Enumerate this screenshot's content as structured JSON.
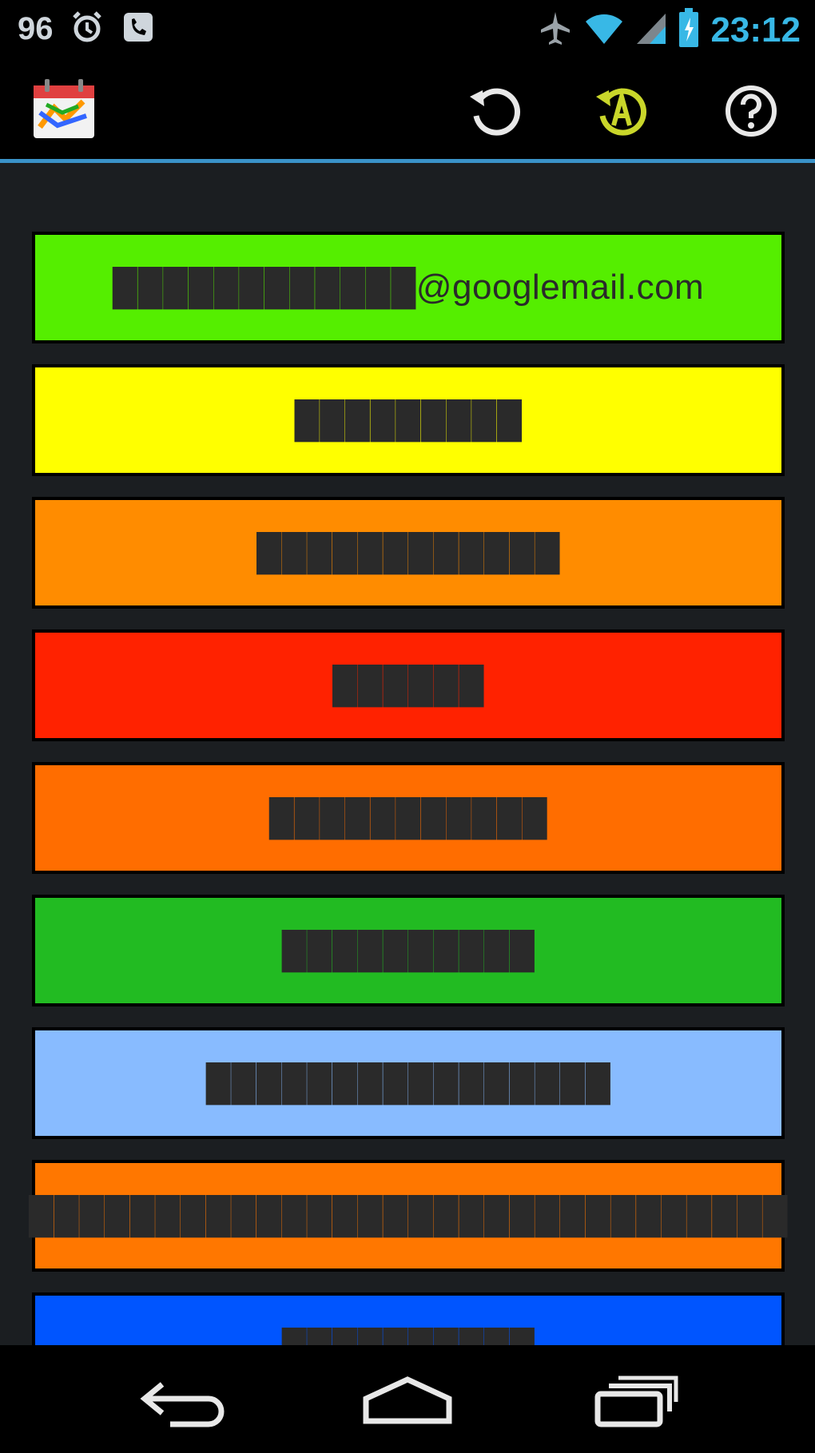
{
  "status_bar": {
    "battery_percent": "96",
    "time": "23:12",
    "icons": [
      "alarm-icon",
      "phone-app-icon",
      "airplane-icon",
      "wifi-icon",
      "signal-icon",
      "battery-icon"
    ]
  },
  "action_bar": {
    "app_icon": "calendar-app-icon",
    "actions": [
      "refresh-icon",
      "auto-sync-icon",
      "help-icon"
    ]
  },
  "accounts": [
    {
      "label": "████████████@googlemail.com",
      "color": "#55ee00"
    },
    {
      "label": "█████████",
      "color": "#ffff00"
    },
    {
      "label": "████████████",
      "color": "#ff8c00"
    },
    {
      "label": "██████",
      "color": "#ff2200"
    },
    {
      "label": "███████████",
      "color": "#ff6d00"
    },
    {
      "label": "██████████",
      "color": "#22bb22"
    },
    {
      "label": "████████████████",
      "color": "#88bbff"
    },
    {
      "label": "██████████████████████████████",
      "color": "#ff7700"
    },
    {
      "label": "██████████",
      "color": "#0055ff"
    }
  ],
  "nav_bar": {
    "buttons": [
      "back-icon",
      "home-icon",
      "recent-apps-icon"
    ]
  }
}
